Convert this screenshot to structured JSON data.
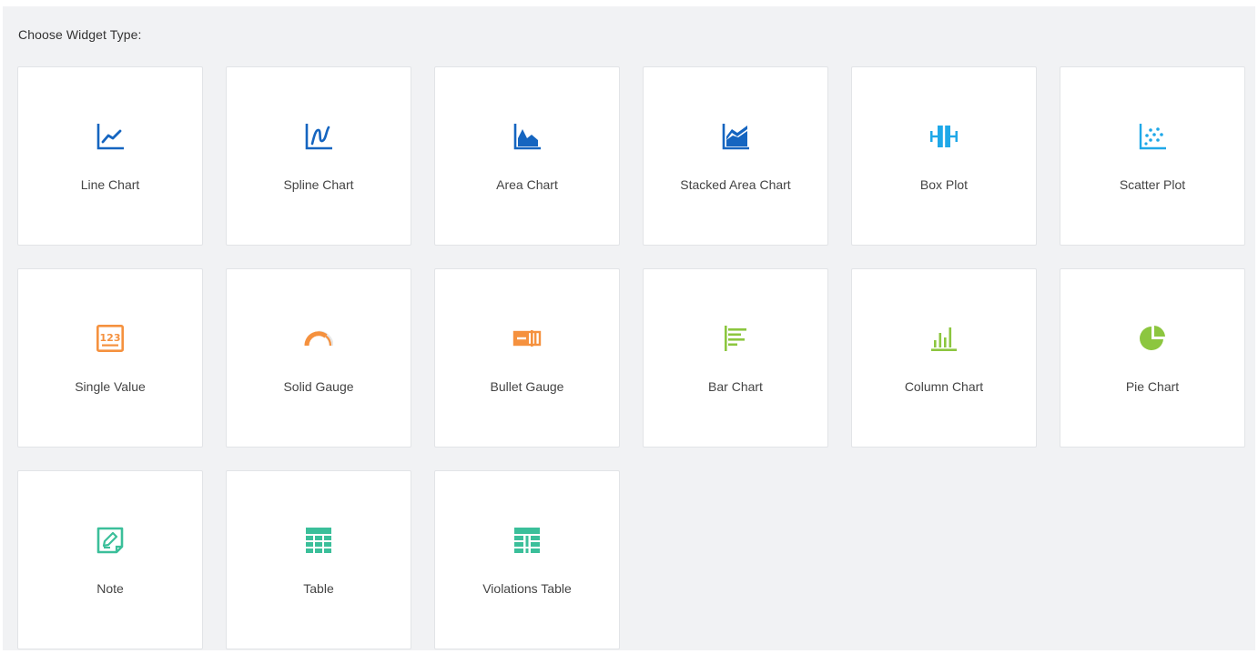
{
  "heading": "Choose Widget Type:",
  "colors": {
    "blue": "#1565c0",
    "cyan": "#1fa8e8",
    "orange": "#f5913e",
    "green": "#8cc63f",
    "teal": "#3bbf9a"
  },
  "widgets": [
    {
      "label": "Line Chart",
      "icon": "line-chart-icon"
    },
    {
      "label": "Spline Chart",
      "icon": "spline-chart-icon"
    },
    {
      "label": "Area Chart",
      "icon": "area-chart-icon"
    },
    {
      "label": "Stacked Area Chart",
      "icon": "stacked-area-chart-icon"
    },
    {
      "label": "Box Plot",
      "icon": "box-plot-icon"
    },
    {
      "label": "Scatter Plot",
      "icon": "scatter-plot-icon"
    },
    {
      "label": "Single Value",
      "icon": "single-value-icon"
    },
    {
      "label": "Solid Gauge",
      "icon": "solid-gauge-icon"
    },
    {
      "label": "Bullet Gauge",
      "icon": "bullet-gauge-icon"
    },
    {
      "label": "Bar Chart",
      "icon": "bar-chart-icon"
    },
    {
      "label": "Column Chart",
      "icon": "column-chart-icon"
    },
    {
      "label": "Pie Chart",
      "icon": "pie-chart-icon"
    },
    {
      "label": "Note",
      "icon": "note-icon"
    },
    {
      "label": "Table",
      "icon": "table-icon"
    },
    {
      "label": "Violations Table",
      "icon": "violations-table-icon"
    }
  ]
}
